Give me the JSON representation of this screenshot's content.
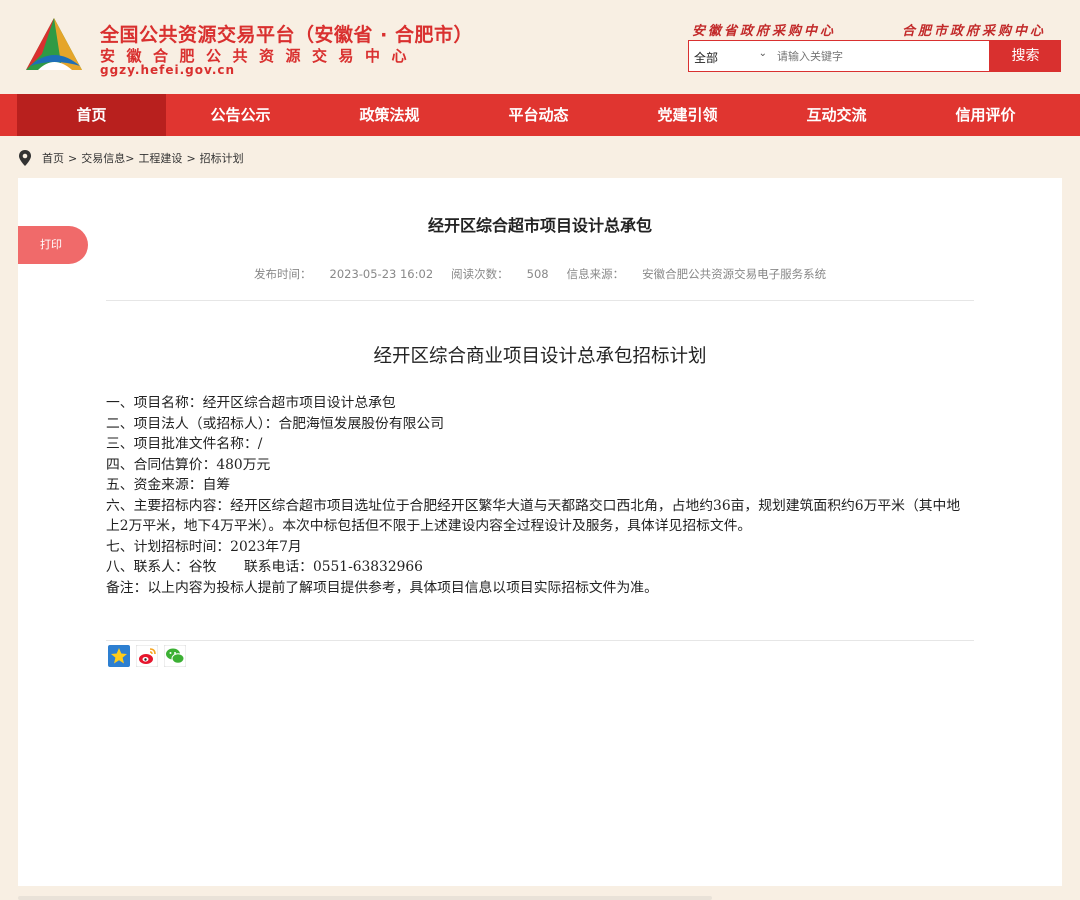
{
  "header": {
    "site_title": "全国公共资源交易平台（安徽省 · 合肥市）",
    "site_subtitle": "安徽合肥公共资源交易中心",
    "site_url": "ggzy.hefei.gov.cn",
    "top_links": [
      "安徽省政府采购中心",
      "合肥市政府采购中心"
    ],
    "search": {
      "category": "全部",
      "placeholder": "请输入关键字",
      "button": "搜索"
    }
  },
  "nav": {
    "items": [
      "首页",
      "公告公示",
      "政策法规",
      "平台动态",
      "党建引领",
      "互动交流",
      "信用评价"
    ],
    "active": "首页"
  },
  "breadcrumb": [
    "首页",
    ">",
    "交易信息>",
    "工程建设",
    ">",
    "招标计划"
  ],
  "article": {
    "print_label": "打印",
    "title": "经开区综合超市项目设计总承包",
    "meta": {
      "publish_label": "发布时间：",
      "publish_time": "2023-05-23 16:02",
      "views_label": "阅读次数：",
      "views": "508",
      "source_label": "信息来源：",
      "source": "安徽合肥公共资源交易电子服务系统"
    },
    "content_title": "经开区综合商业项目设计总承包招标计划",
    "lines": [
      "一、项目名称：经开区综合超市项目设计总承包",
      "二、项目法人（或招标人）：合肥海恒发展股份有限公司",
      "三、项目批准文件名称：/",
      "四、合同估算价：480万元",
      "五、资金来源：自筹",
      "六、主要招标内容：经开区综合超市项目选址位于合肥经开区繁华大道与天都路交口西北角，占地约36亩，规划建筑面积约6万平米（其中地上2万平米，地下4万平米）。本次中标包括但不限于上述建设内容全过程设计及服务，具体详见招标文件。",
      "七、计划招标时间：2023年7月",
      "八、联系人：谷牧　　联系电话：0551-63832966",
      "备注：以上内容为投标人提前了解项目提供参考，具体项目信息以项目实际招标文件为准。"
    ]
  },
  "colors": {
    "brand_red": "#d9302f",
    "nav_active": "#b8201e",
    "print_tab": "#f06a6a",
    "page_bg": "#f8efe3"
  },
  "share_icons": [
    "qzone-star-icon",
    "weibo-icon",
    "wechat-icon"
  ]
}
